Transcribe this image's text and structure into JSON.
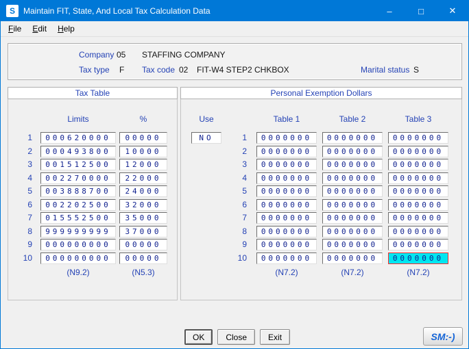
{
  "window": {
    "title": "Maintain FIT, State, And Local Tax Calculation Data",
    "icon_letter": "S",
    "menu": [
      {
        "label": "File"
      },
      {
        "label": "Edit"
      },
      {
        "label": "Help"
      }
    ],
    "controls": {
      "minimize": "–",
      "maximize": "□",
      "close": "✕"
    }
  },
  "header": {
    "company": {
      "label": "Company",
      "code": "05",
      "name": "STAFFING COMPANY"
    },
    "tax_type": {
      "label": "Tax type",
      "value": "F"
    },
    "tax_code": {
      "label": "Tax code",
      "value": "02",
      "name": "FIT-W4 STEP2 CHKBOX"
    },
    "marital_status": {
      "label": "Marital status",
      "value": "S"
    }
  },
  "tax_table": {
    "title": "Tax Table",
    "columns": [
      "Limits",
      "%"
    ],
    "rows": [
      {
        "num": "1",
        "limit": "000620000",
        "pct": "00000"
      },
      {
        "num": "2",
        "limit": "000493800",
        "pct": "10000"
      },
      {
        "num": "3",
        "limit": "001512500",
        "pct": "12000"
      },
      {
        "num": "4",
        "limit": "002270000",
        "pct": "22000"
      },
      {
        "num": "5",
        "limit": "003888700",
        "pct": "24000"
      },
      {
        "num": "6",
        "limit": "002202500",
        "pct": "32000"
      },
      {
        "num": "7",
        "limit": "015552500",
        "pct": "35000"
      },
      {
        "num": "8",
        "limit": "999999999",
        "pct": "37000"
      },
      {
        "num": "9",
        "limit": "000000000",
        "pct": "00000"
      },
      {
        "num": "10",
        "limit": "000000000",
        "pct": "00000"
      }
    ],
    "footers": [
      "(N9.2)",
      "(N5.3)"
    ]
  },
  "personal_exemption": {
    "title": "Personal Exemption Dollars",
    "use_label": "Use",
    "use_value": "NO",
    "columns": [
      "Table 1",
      "Table 2",
      "Table 3"
    ],
    "rows": [
      {
        "num": "1",
        "values": [
          "0000000",
          "0000000",
          "0000000"
        ]
      },
      {
        "num": "2",
        "values": [
          "0000000",
          "0000000",
          "0000000"
        ]
      },
      {
        "num": "3",
        "values": [
          "0000000",
          "0000000",
          "0000000"
        ]
      },
      {
        "num": "4",
        "values": [
          "0000000",
          "0000000",
          "0000000"
        ]
      },
      {
        "num": "5",
        "values": [
          "0000000",
          "0000000",
          "0000000"
        ]
      },
      {
        "num": "6",
        "values": [
          "0000000",
          "0000000",
          "0000000"
        ]
      },
      {
        "num": "7",
        "values": [
          "0000000",
          "0000000",
          "0000000"
        ]
      },
      {
        "num": "8",
        "values": [
          "0000000",
          "0000000",
          "0000000"
        ]
      },
      {
        "num": "9",
        "values": [
          "0000000",
          "0000000",
          "0000000"
        ]
      },
      {
        "num": "10",
        "values": [
          "0000000",
          "0000000",
          "0000000"
        ]
      }
    ],
    "footers": [
      "(N7.2)",
      "(N7.2)",
      "(N7.2)"
    ],
    "focused_cell": {
      "row": 10,
      "column": 3
    }
  },
  "buttons": [
    {
      "label": "OK"
    },
    {
      "label": "Close"
    },
    {
      "label": "Exit"
    }
  ],
  "logo": "SM:-)",
  "colors": {
    "titlebar": "#0078d7",
    "label_blue": "#2442b5",
    "value_blue": "#10218f",
    "focus_bg": "#00e6f0",
    "focus_border": "#ff2a2a"
  }
}
